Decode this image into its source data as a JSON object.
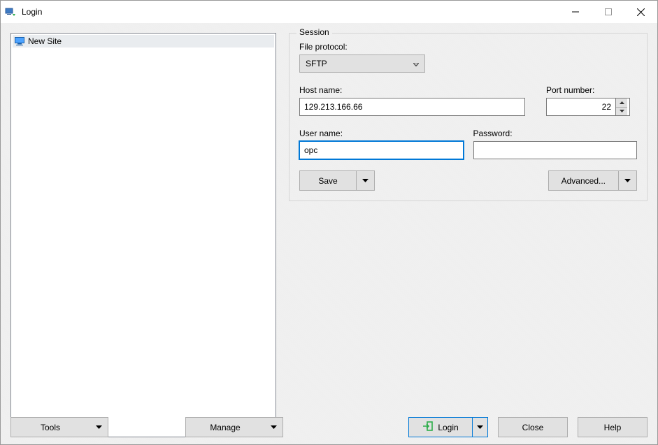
{
  "window": {
    "title": "Login"
  },
  "sidebar": {
    "items": [
      {
        "label": "New Site"
      }
    ]
  },
  "bottom_left": {
    "tools_label": "Tools",
    "manage_label": "Manage"
  },
  "session": {
    "legend": "Session",
    "file_protocol_label": "File protocol:",
    "file_protocol_value": "SFTP",
    "host_label": "Host name:",
    "host_value": "129.213.166.66",
    "port_label": "Port number:",
    "port_value": "22",
    "user_label": "User name:",
    "user_value": "opc",
    "password_label": "Password:",
    "password_value": "",
    "save_label": "Save",
    "advanced_label": "Advanced..."
  },
  "footer": {
    "login_label": "Login",
    "close_label": "Close",
    "help_label": "Help"
  }
}
